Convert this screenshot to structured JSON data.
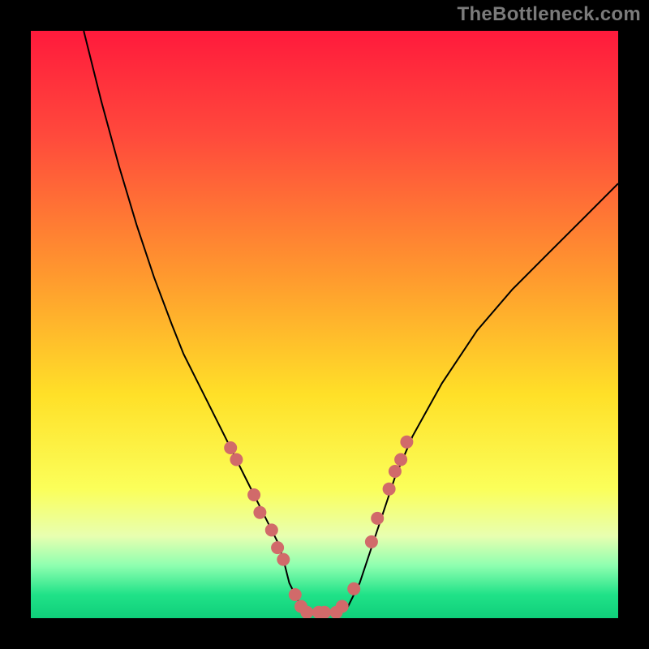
{
  "watermark": "TheBottleneck.com",
  "chart_data": {
    "type": "line",
    "title": "",
    "xlabel": "",
    "ylabel": "",
    "xlim": [
      0,
      100
    ],
    "ylim": [
      0,
      100
    ],
    "background_gradient": {
      "stops": [
        {
          "offset": 0.0,
          "color": "#ff1a3c"
        },
        {
          "offset": 0.18,
          "color": "#ff4a3c"
        },
        {
          "offset": 0.42,
          "color": "#ff9a2e"
        },
        {
          "offset": 0.62,
          "color": "#ffe028"
        },
        {
          "offset": 0.78,
          "color": "#fbff5a"
        },
        {
          "offset": 0.86,
          "color": "#e8ffb0"
        },
        {
          "offset": 0.91,
          "color": "#8fffb0"
        },
        {
          "offset": 0.96,
          "color": "#20e288"
        },
        {
          "offset": 1.0,
          "color": "#0fcf7a"
        }
      ]
    },
    "series": [
      {
        "name": "bottleneck-curve",
        "x": [
          9,
          12,
          15,
          18,
          21,
          24,
          26,
          28,
          30,
          32,
          34,
          36,
          38,
          40,
          42,
          43,
          44,
          46,
          48,
          51,
          54,
          56,
          58,
          60,
          62,
          65,
          70,
          76,
          82,
          88,
          94,
          100
        ],
        "y": [
          100,
          88,
          77,
          67,
          58,
          50,
          45,
          41,
          37,
          33,
          29,
          25,
          21,
          17,
          13,
          10,
          6,
          2,
          1,
          1,
          2,
          6,
          12,
          18,
          24,
          31,
          40,
          49,
          56,
          62,
          68,
          74
        ],
        "stroke": "#000000",
        "stroke_width": 2
      }
    ],
    "markers": {
      "name": "highlight-dots",
      "color": "#d16a6a",
      "radius": 8,
      "points": [
        {
          "x": 34,
          "y": 29
        },
        {
          "x": 35,
          "y": 27
        },
        {
          "x": 38,
          "y": 21
        },
        {
          "x": 39,
          "y": 18
        },
        {
          "x": 41,
          "y": 15
        },
        {
          "x": 42,
          "y": 12
        },
        {
          "x": 43,
          "y": 10
        },
        {
          "x": 45,
          "y": 4
        },
        {
          "x": 46,
          "y": 2
        },
        {
          "x": 47,
          "y": 1
        },
        {
          "x": 49,
          "y": 1
        },
        {
          "x": 50,
          "y": 1
        },
        {
          "x": 52,
          "y": 1
        },
        {
          "x": 53,
          "y": 2
        },
        {
          "x": 55,
          "y": 5
        },
        {
          "x": 58,
          "y": 13
        },
        {
          "x": 59,
          "y": 17
        },
        {
          "x": 61,
          "y": 22
        },
        {
          "x": 62,
          "y": 25
        },
        {
          "x": 63,
          "y": 27
        },
        {
          "x": 64,
          "y": 30
        }
      ]
    }
  }
}
